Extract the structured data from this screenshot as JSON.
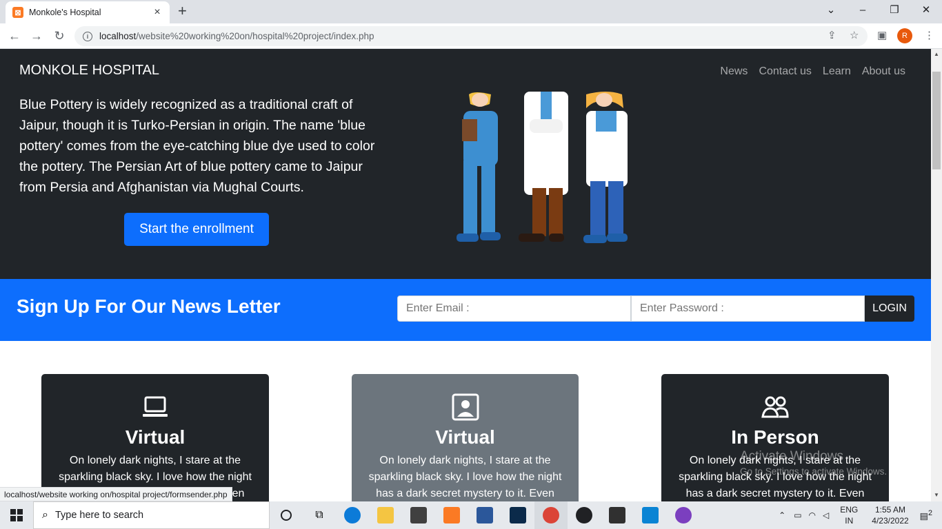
{
  "browser": {
    "tab_title": "Monkole's Hospital",
    "tab_close": "×",
    "new_tab": "+",
    "url_host": "localhost",
    "url_path": "/website%20working%20on/hospital%20project/index.php",
    "profile_initial": "R",
    "status_url": "localhost/website working on/hospital project/formsender.php"
  },
  "site": {
    "brand": "MONKOLE HOSPITAL",
    "nav": [
      "News",
      "Contact us",
      "Learn",
      "About us"
    ],
    "hero_text": "Blue Pottery is widely recognized as a traditional craft of Jaipur, though it is Turko-Persian in origin. The name 'blue pottery' comes from the eye-catching blue dye used to color the pottery. The Persian Art of blue pottery came to Jaipur from Persia and Afghanistan via Mughal Courts.",
    "enroll_button": "Start the enrollment",
    "newsletter": {
      "title": "Sign Up For Our News Letter",
      "email_placeholder": "Enter Email :",
      "password_placeholder": "Enter Password :",
      "login_button": "LOGIN"
    },
    "cards": [
      {
        "icon": "laptop-icon",
        "title": "Virtual",
        "text": "On lonely dark nights, I stare at the sparkling black sky. I love how the night has a dark secret mystery to it. Even when"
      },
      {
        "icon": "person-badge-icon",
        "title": "Virtual",
        "text": "On lonely dark nights, I stare at the sparkling black sky. I love how the night has a dark secret mystery to it. Even when"
      },
      {
        "icon": "people-icon",
        "title": "In Person",
        "text": "On lonely dark nights, I stare at the sparkling black sky. I love how the night has a dark secret mystery to it. Even when"
      }
    ]
  },
  "overlay": {
    "activate_title": "Activate Windows",
    "activate_sub": "Go to Settings to activate Windows."
  },
  "taskbar": {
    "search_placeholder": "Type here to search",
    "lang_top": "ENG",
    "lang_bottom": "IN",
    "time": "1:55 AM",
    "date": "4/23/2022",
    "notifications": "2"
  },
  "colors": {
    "dark": "#212529",
    "primary": "#0d6efd",
    "grey": "#6c757d"
  }
}
